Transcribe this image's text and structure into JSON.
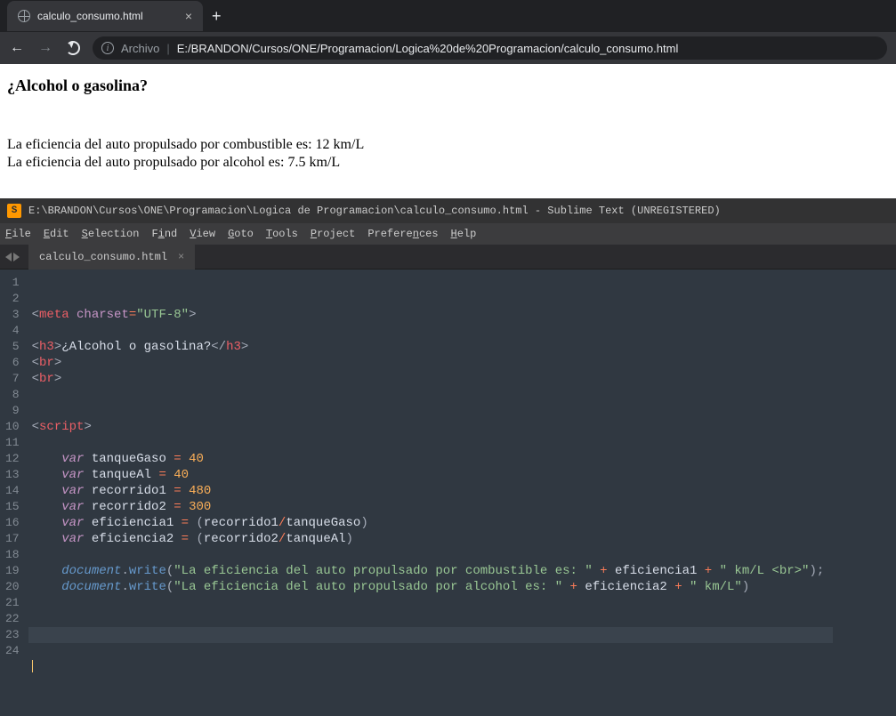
{
  "browser": {
    "tab_title": "calculo_consumo.html",
    "new_tab": "+",
    "close": "×",
    "file_label": "Archivo",
    "url": "E:/BRANDON/Cursos/ONE/Programacion/Logica%20de%20Programacion/calculo_consumo.html",
    "sep": "|"
  },
  "page": {
    "heading": "¿Alcohol o gasolina?",
    "line1": "La eficiencia del auto propulsado por combustible es: 12 km/L",
    "line2": "La eficiencia del auto propulsado por alcohol es: 7.5 km/L"
  },
  "sublime": {
    "title": "E:\\BRANDON\\Cursos\\ONE\\Programacion\\Logica de Programacion\\calculo_consumo.html - Sublime Text (UNREGISTERED)",
    "logo": "S",
    "menu": {
      "file": "File",
      "edit": "Edit",
      "selection": "Selection",
      "find": "Find",
      "view": "View",
      "goto": "Goto",
      "tools": "Tools",
      "project": "Project",
      "preferences": "Preferences",
      "help": "Help"
    },
    "tab": {
      "name": "calculo_consumo.html",
      "close": "×"
    },
    "gutter": [
      "1",
      "2",
      "3",
      "4",
      "5",
      "6",
      "7",
      "8",
      "9",
      "10",
      "11",
      "12",
      "13",
      "14",
      "15",
      "16",
      "17",
      "18",
      "19",
      "20",
      "21",
      "22",
      "23",
      "24"
    ],
    "code": {
      "t_meta": "meta",
      "a_charset": "charset",
      "v_utf8": "\"UTF-8\"",
      "t_h3": "h3",
      "txt_h3": "¿Alcohol o gasolina?",
      "t_br": "br",
      "t_script": "script",
      "kw_var": "var",
      "id_tanqueGaso": "tanqueGaso",
      "id_tanqueAl": "tanqueAl",
      "id_rec1": "recorrido1",
      "id_rec2": "recorrido2",
      "id_ef1": "eficiencia1",
      "id_ef2": "eficiencia2",
      "n40a": "40",
      "n40b": "40",
      "n480": "480",
      "n300": "300",
      "obj_document": "document",
      "fn_write": "write",
      "s1": "\"La eficiencia del auto propulsado por combustible es: \"",
      "s2": "\" km/L <br>\"",
      "s3": "\"La eficiencia del auto propulsado por alcohol es: \"",
      "s4": "\" km/L\"",
      "plus": "+",
      "eq": "=",
      "slash": "/",
      "dot": ".",
      "lp": "(",
      "rp": ")",
      "lt": "<",
      "gt": ">",
      "ltc": "</",
      "sc": ";"
    }
  }
}
